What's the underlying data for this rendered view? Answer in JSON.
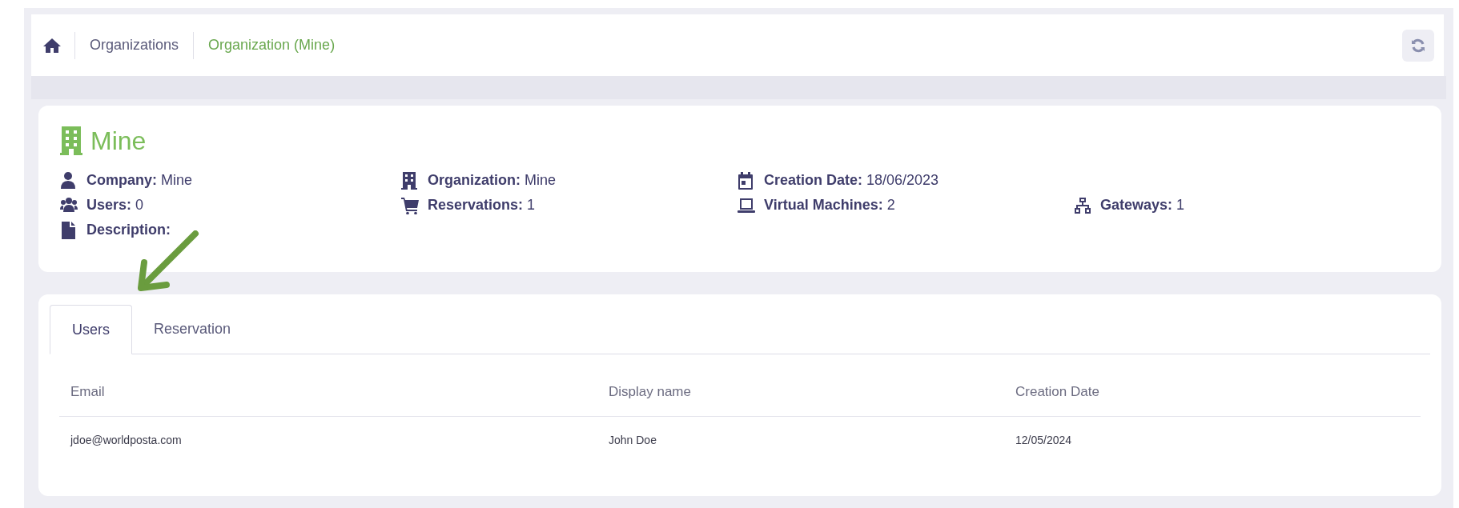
{
  "breadcrumb": [
    {
      "label": "Organizations",
      "current": false
    },
    {
      "label": "Organization (Mine)",
      "current": true
    }
  ],
  "title": "Mine",
  "detail_columns": [
    [
      {
        "label": "Company:",
        "value": "Mine"
      },
      {
        "label": "Users:",
        "value": "0"
      },
      {
        "label": "Description:"
      }
    ],
    [
      {
        "label": "Organization:",
        "value": "Mine"
      },
      {
        "label": "Reservations:",
        "value": "1"
      }
    ],
    [
      {
        "label": "Creation Date:",
        "value": "18/06/2023"
      },
      {
        "label": "Virtual Machines:",
        "value": "2"
      }
    ],
    [
      {
        "label": "Gateways:",
        "value": "1"
      }
    ]
  ],
  "tabs": [
    {
      "label": "Users",
      "selected": true
    },
    {
      "label": "Reservation",
      "selected": false
    }
  ],
  "table": {
    "columns": [
      "Email",
      "Display name",
      "Creation Date"
    ],
    "rows": [
      [
        "jdoe@worldposta.com",
        "John Doe",
        "12/05/2024"
      ]
    ]
  }
}
